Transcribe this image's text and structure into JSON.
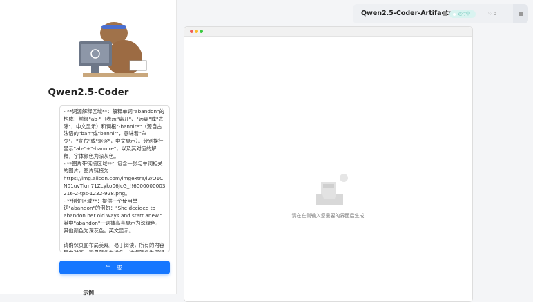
{
  "left": {
    "title": "Qwen2.5-Coder",
    "prompt_value": "- **词源解释区域**：解释单词\"abandon\"的构成：前缀\"ab-\"（表示\"离开\"、\"远离\"或\"去除\"，中文显示）和词根\"-bannire\"（源自古法语的\"ban\"或\"bannir\"，意味着\"命令\"、\"宣布\"或\"驱逐\"，中文显示）。分别换行显示\"ab-\"+\"-bannire\"，以及其对应的解释，字体颜色为深灰色。\n- **图片带链接区域**：包含一张与单词相关的图片，图片链接为https://img.alicdn.com/imgextra/i2/O1CN01uvTkm71Zcyko06JcG_!!6000000003216-2-tps-1232-928.png。\n- **例句区域**：提供一个使用单词\"abandon\"的例句：\"She decided to abandon her old ways and start anew.\" 其中\"abandon\"一词被高亮显示为深绿色，其他颜色为深灰色。英文显示。\n\n请确保页面布局美观，易于阅读，所有的内容居中对齐，背景颜色为浅色，边框颜色为深绿色。",
    "generate_label": "生 成",
    "examples_label": "示例"
  },
  "header": {
    "app_name": "Qwen2.5-Coder-Artifacts",
    "status_badge": "运行中",
    "likes": "0",
    "accent": "#1677ff"
  },
  "preview": {
    "empty_text": "请在左侧输入您需要的界面后生成"
  }
}
